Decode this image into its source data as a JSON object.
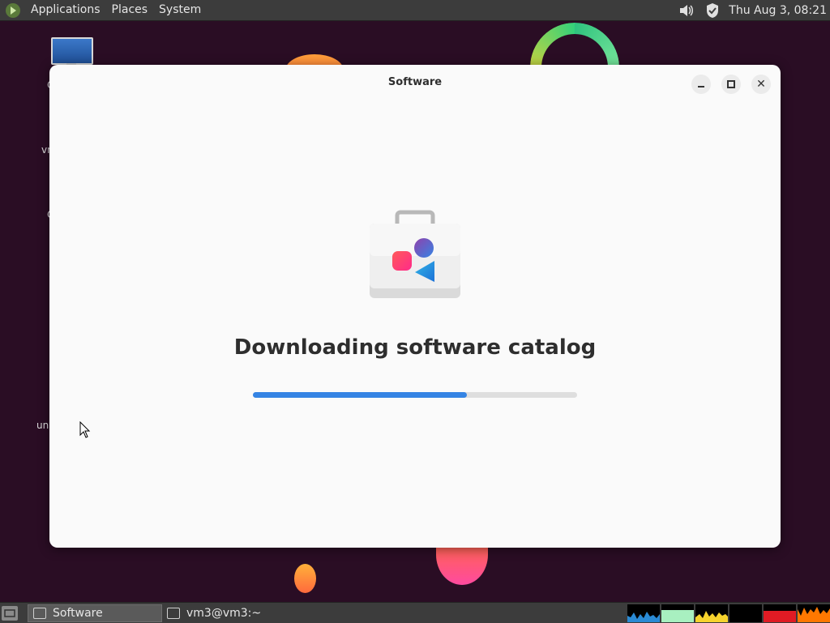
{
  "top_panel": {
    "menus": [
      "Applications",
      "Places",
      "System"
    ],
    "clock": "Thu Aug  3, 08:21"
  },
  "desktop": {
    "icon_labels": [
      "C",
      "vn",
      "C",
      "un"
    ]
  },
  "window": {
    "title": "Software",
    "headline": "Downloading software catalog",
    "progress": 0.66
  },
  "taskbar": {
    "tasks": [
      {
        "label": "Software",
        "active": true
      },
      {
        "label": "vm3@vm3:~",
        "active": false
      }
    ]
  },
  "colors": {
    "accent": "#3584e4",
    "panel": "#3c3c3c",
    "window_bg": "#fafafa"
  }
}
